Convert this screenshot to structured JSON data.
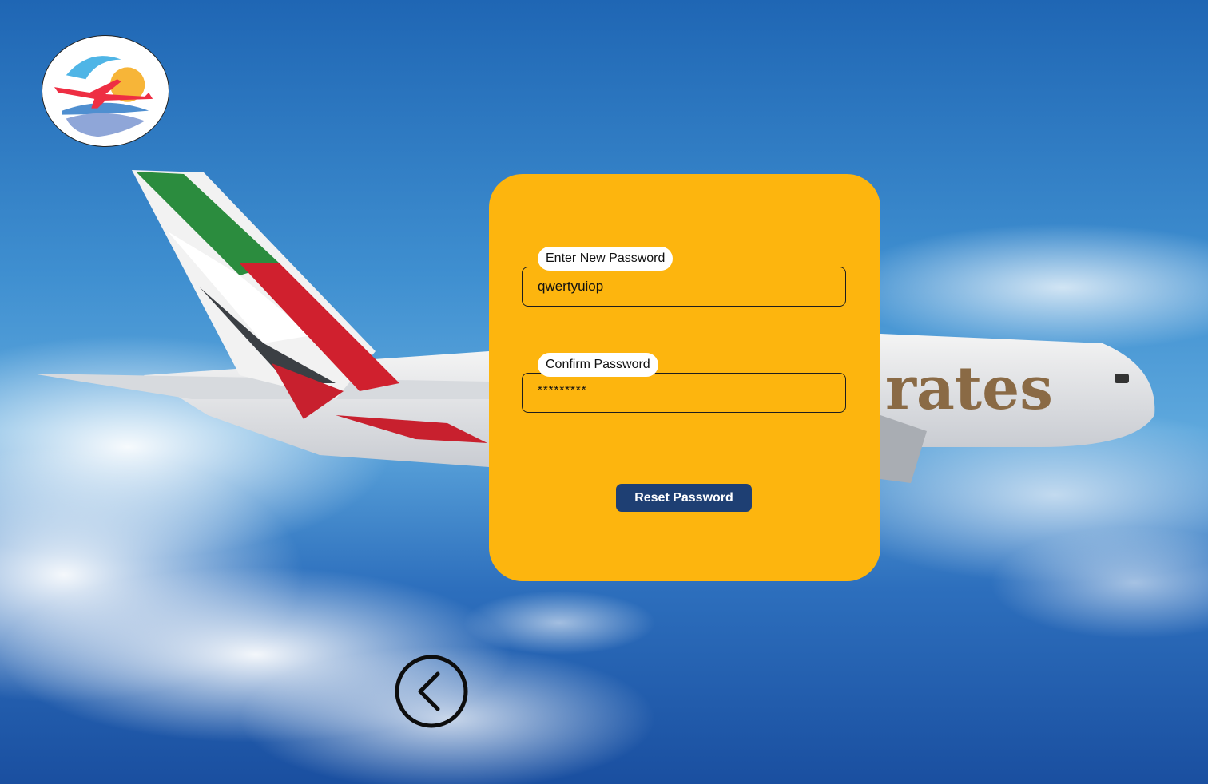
{
  "background": {
    "description_icon": "airplane-sky-background",
    "aircraft_livery_text": "rates"
  },
  "logo": {
    "icon": "airline-logo-icon"
  },
  "form": {
    "new_password": {
      "label": "Enter New Password",
      "value": "qwertyuiop"
    },
    "confirm_password": {
      "label": "Confirm Password",
      "value": "*********"
    },
    "reset_button_label": "Reset Password"
  },
  "navigation": {
    "back_icon": "chevron-left-circle-icon"
  },
  "colors": {
    "card": "#FDB50E",
    "button": "#1e3f73",
    "label_bg": "#ffffff"
  }
}
